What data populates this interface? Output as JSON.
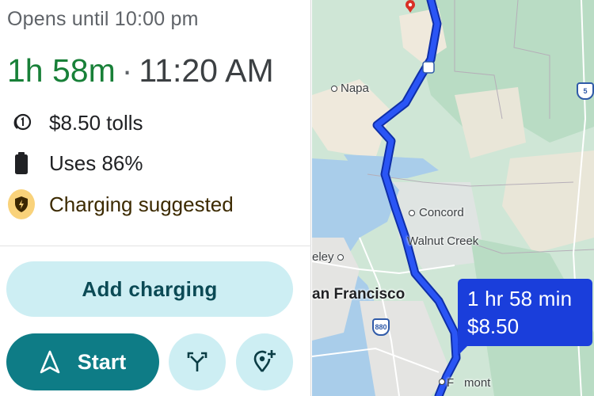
{
  "route": {
    "hours_text": "Opens until 10:00 pm",
    "duration": "1h 58m",
    "separator": "·",
    "arrival": "11:20 AM",
    "tolls": "$8.50 tolls",
    "battery": "Uses 86%",
    "charging_note": "Charging suggested"
  },
  "actions": {
    "add_charging": "Add charging",
    "start": "Start"
  },
  "map": {
    "labels": {
      "napa": "Napa",
      "concord": "Concord",
      "walnut_creek": "Walnut Creek",
      "berkeley": "eley",
      "san_francisco": "an Francisco",
      "fremont": "mont",
      "fremont_prefix": "F"
    },
    "highways": {
      "i880": "880",
      "i5": "5"
    },
    "callout": {
      "duration": "1 hr 58 min",
      "toll": "$8.50"
    }
  },
  "colors": {
    "eta_green": "#188038",
    "route_blue": "#1a3edb",
    "start_teal": "#0e7c86",
    "pill_light": "#cdeef3",
    "badge_yellow": "#f9d27a"
  }
}
